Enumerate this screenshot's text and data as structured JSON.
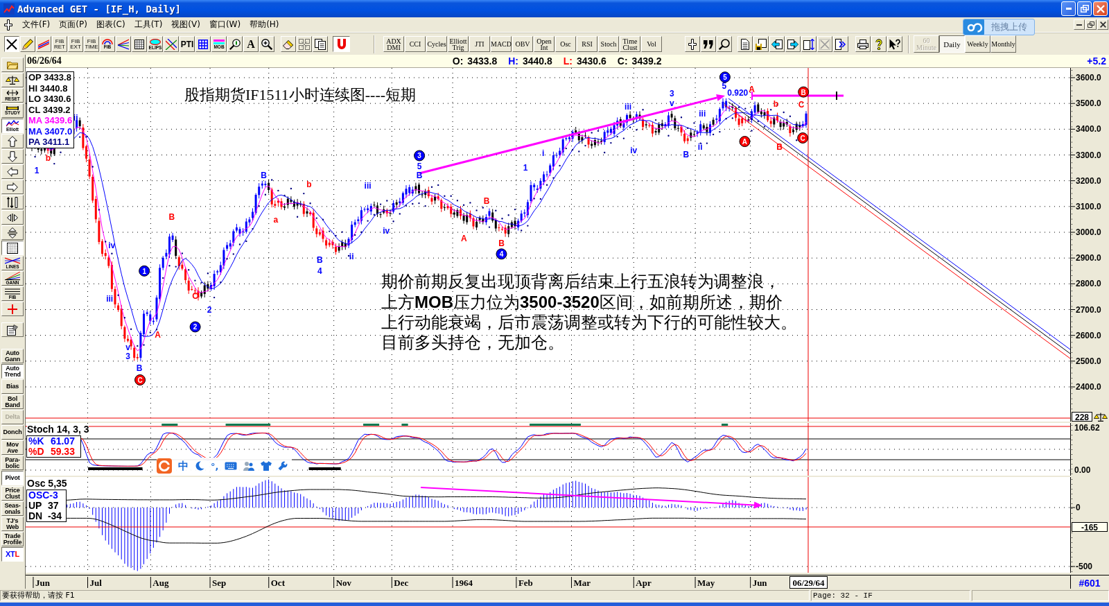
{
  "window": {
    "title": "Advanced GET - [IF_H, Daily]"
  },
  "menu": [
    "文件(F)",
    "页面(P)",
    "图表(C)",
    "工具(T)",
    "视图(V)",
    "窗口(W)",
    "帮助(H)"
  ],
  "toolbar": {
    "drawing_tools": [
      {
        "on": true
      },
      {
        "on": false
      },
      {
        "on": false
      },
      {
        "label": "FIB RET",
        "on": false
      },
      {
        "label": "FIB EXT",
        "on": false
      },
      {
        "label": "FIB TIME",
        "on": false
      },
      {
        "label": "FIB",
        "on": false
      },
      {
        "on": false
      },
      {
        "on": false
      },
      {
        "label": "ELIPS",
        "on": false
      },
      {
        "on": false
      },
      {
        "label": "PTI",
        "on": false
      },
      {
        "on": false
      },
      {
        "label": "MOB",
        "on": false
      },
      {
        "on": false
      },
      {
        "label": "A",
        "on": false
      },
      {
        "on": false
      }
    ],
    "magnet": {
      "on": true
    },
    "studies": [
      "ADX DMI",
      "CCI",
      "Cycles",
      "Elliott Trig",
      "JTI",
      "MACD",
      "OBV",
      "Open Int",
      "Osc",
      "RSI",
      "Stoch",
      "Time Clust",
      "Vol"
    ],
    "timeframes": [
      {
        "label": "60 Minute",
        "selected": false,
        "disabled": true
      },
      {
        "label": "Daily",
        "selected": true,
        "disabled": false
      },
      {
        "label": "Weekly",
        "selected": false,
        "disabled": false
      },
      {
        "label": "Monthly",
        "selected": false,
        "disabled": false
      }
    ]
  },
  "upload_widget": {
    "label": "拖拽上传"
  },
  "info_bar": {
    "date": "06/26/64",
    "quotes": [
      {
        "label": "O:",
        "value": "3433.8",
        "color": "#000000"
      },
      {
        "label": "H:",
        "value": "3440.8",
        "color": "#0000ff"
      },
      {
        "label": "L:",
        "value": "3430.6",
        "color": "#ff0000"
      },
      {
        "label": "C:",
        "value": "3439.2",
        "color": "#000000"
      }
    ],
    "change": "+5.2"
  },
  "sidebar": {
    "tools": [
      {
        "on": false
      },
      {
        "on": false
      },
      {
        "label": "RESET",
        "on": false
      },
      {
        "label": "STUDY",
        "on": false
      },
      {
        "label": "Elliott",
        "on": true
      },
      {
        "on": false
      },
      {
        "on": false
      },
      {
        "on": false
      },
      {
        "on": false
      },
      {
        "on": false
      },
      {
        "on": false
      },
      {
        "on": false
      },
      {
        "on": true
      },
      {
        "label": "LINES",
        "on": false
      },
      {
        "label": "GANN",
        "on": false
      },
      {
        "label": "FIB",
        "on": false
      },
      {
        "on": false
      },
      {
        "on": false
      }
    ],
    "studies": [
      {
        "label": "Auto Gann",
        "on": false,
        "disabled": false
      },
      {
        "label": "Auto Trend",
        "on": true,
        "disabled": false
      },
      {
        "label": "Bias",
        "on": false,
        "disabled": false
      },
      {
        "label": "Bol Band",
        "on": false,
        "disabled": false
      },
      {
        "label": "Delta",
        "on": false,
        "disabled": true
      },
      {
        "label": "Donch",
        "on": false,
        "disabled": false
      },
      {
        "label": "Mov Ave",
        "on": false,
        "disabled": false
      },
      {
        "label": "Para-bolic",
        "on": false,
        "disabled": false
      },
      {
        "label": "Pivot",
        "on": true,
        "disabled": false
      },
      {
        "label": "Price Clust",
        "on": false,
        "disabled": false
      },
      {
        "label": "Seas-onals",
        "on": false,
        "disabled": false
      },
      {
        "label": "TJ's Web",
        "on": false,
        "disabled": false
      },
      {
        "label": "Trade Profile",
        "on": false,
        "disabled": false
      },
      {
        "parts": [
          {
            "text": "XT",
            "color": "#0000ff"
          },
          {
            "text": "L",
            "color": "#ff0000"
          }
        ],
        "on": true,
        "disabled": false
      }
    ]
  },
  "price_chart": {
    "title": "股指期货IF1511小时连续图----短期",
    "legend": [
      {
        "label": "OP",
        "value": "3433.8",
        "color": "#000000"
      },
      {
        "label": "HI",
        "value": "3440.8",
        "color": "#000000"
      },
      {
        "label": "LO",
        "value": "3430.6",
        "color": "#000000"
      },
      {
        "label": "CL",
        "value": "3439.2",
        "color": "#000000"
      },
      {
        "label": "MA",
        "value": "3439.6",
        "color": "#ff00ff"
      },
      {
        "label": "MA",
        "value": "3407.0",
        "color": "#0000ff"
      },
      {
        "label": "PA",
        "value": "3411.1",
        "color": "#000080"
      }
    ],
    "note": [
      "期价前期反复出现顶背离后结束上行五浪转为调整浪，",
      "上方**MOB**压力位为**3500-3520**区间，如前期所述，期价",
      "上行动能衰竭，后市震荡调整或转为下行的可能性较大。",
      "目前多头持仓，无加仓。"
    ],
    "wave_labels": [
      {
        "text": "1",
        "kind": "plain",
        "color": "#0000ff"
      },
      {
        "text": "b",
        "kind": "plain",
        "color": "#ff0000"
      },
      {
        "text": "ii",
        "kind": "plain",
        "color": "#0000ff"
      },
      {
        "text": "iv",
        "kind": "plain",
        "color": "#0000ff"
      },
      {
        "text": "iii",
        "kind": "plain",
        "color": "#0000ff"
      },
      {
        "text": "v",
        "kind": "plain",
        "color": "#0000ff"
      },
      {
        "text": "3",
        "kind": "plain",
        "color": "#0000ff"
      },
      {
        "text": "B",
        "kind": "plain",
        "color": "#0000ff"
      },
      {
        "text": "C",
        "kind": "marker",
        "color": "#ff0000"
      },
      {
        "text": "1",
        "kind": "marker",
        "color": "#0000ff"
      },
      {
        "text": "A",
        "kind": "plain",
        "color": "#ff0000"
      },
      {
        "text": "B",
        "kind": "plain",
        "color": "#ff0000"
      },
      {
        "text": "C",
        "kind": "plain",
        "color": "#ff0000"
      },
      {
        "text": "2",
        "kind": "marker",
        "color": "#0000ff"
      },
      {
        "text": "2",
        "kind": "plain",
        "color": "#0000ff"
      },
      {
        "text": "B",
        "kind": "plain",
        "color": "#0000ff"
      },
      {
        "text": "a",
        "kind": "plain",
        "color": "#ff0000"
      },
      {
        "text": "b",
        "kind": "plain",
        "color": "#ff0000"
      },
      {
        "text": "B",
        "kind": "plain",
        "color": "#0000ff"
      },
      {
        "text": "4",
        "kind": "plain",
        "color": "#0000ff"
      },
      {
        "text": "ii",
        "kind": "plain",
        "color": "#0000ff"
      },
      {
        "text": "iii",
        "kind": "plain",
        "color": "#0000ff"
      },
      {
        "text": "iv",
        "kind": "plain",
        "color": "#0000ff"
      },
      {
        "text": "3",
        "kind": "marker",
        "color": "#0000ff"
      },
      {
        "text": "5",
        "kind": "plain",
        "color": "#0000ff"
      },
      {
        "text": "B",
        "kind": "plain",
        "color": "#0000ff"
      },
      {
        "text": "A",
        "kind": "plain",
        "color": "#ff0000"
      },
      {
        "text": "B",
        "kind": "plain",
        "color": "#ff0000"
      },
      {
        "text": "B",
        "kind": "plain",
        "color": "#ff0000"
      },
      {
        "text": "4",
        "kind": "marker",
        "color": "#0000ff"
      },
      {
        "text": "1",
        "kind": "plain",
        "color": "#0000ff"
      },
      {
        "text": "i",
        "kind": "plain",
        "color": "#0000ff"
      },
      {
        "text": "iii",
        "kind": "plain",
        "color": "#0000ff"
      },
      {
        "text": "3",
        "kind": "plain",
        "color": "#0000ff"
      },
      {
        "text": "v",
        "kind": "plain",
        "color": "#0000ff"
      },
      {
        "text": "iv",
        "kind": "plain",
        "color": "#0000ff"
      },
      {
        "text": "iii",
        "kind": "plain",
        "color": "#0000ff"
      },
      {
        "text": "ii",
        "kind": "plain",
        "color": "#0000ff"
      },
      {
        "text": "B",
        "kind": "plain",
        "color": "#0000ff"
      },
      {
        "text": "5",
        "kind": "marker",
        "color": "#0000ff"
      },
      {
        "text": "5",
        "kind": "plain",
        "color": "#0000ff"
      },
      {
        "text": "0.920",
        "kind": "plain",
        "color": "#0000ff"
      },
      {
        "text": "B",
        "kind": "marker",
        "color": "#ff0000"
      },
      {
        "text": "A",
        "kind": "plain",
        "color": "#ff0000"
      },
      {
        "text": "b",
        "kind": "plain",
        "color": "#ff0000"
      },
      {
        "text": "C",
        "kind": "plain",
        "color": "#ff0000"
      },
      {
        "text": "A",
        "kind": "marker",
        "color": "#ff0000"
      },
      {
        "text": "B",
        "kind": "plain",
        "color": "#ff0000"
      },
      {
        "text": "C",
        "kind": "marker",
        "color": "#ff0000"
      }
    ],
    "y_axis": [
      "3600.0",
      "3500.0",
      "3400.0",
      "3300.0",
      "3200.0",
      "3100.0",
      "3000.0",
      "2900.0",
      "2800.0",
      "2700.0",
      "2600.0",
      "2500.0",
      "2400.0"
    ],
    "last_value": "228"
  },
  "stochastic": {
    "title": "Stoch 14, 3, 3",
    "legend": [
      {
        "label": "%K",
        "value": "61.07",
        "color": "#0000ff"
      },
      {
        "label": "%D",
        "value": "59.33",
        "color": "#ff0000"
      }
    ],
    "y_axis": [
      "106.62",
      "0.00"
    ]
  },
  "oscillator": {
    "title": "Osc 5,35",
    "legend": [
      {
        "label": "OSC-3",
        "color": "#0000ff"
      },
      {
        "label": "UP",
        "value": "37",
        "color": "#000000"
      },
      {
        "label": "DN",
        "value": "-34",
        "color": "#000000"
      }
    ],
    "y_axis": [
      "0",
      "-500"
    ],
    "level": "-165"
  },
  "x_axis": {
    "months": [
      "Jun",
      "Jul",
      "Aug",
      "Sep",
      "Oct",
      "Nov",
      "Dec",
      "1964",
      "Feb",
      "Mar",
      "Apr",
      "May",
      "Jun"
    ],
    "cursor_date": "06/29/64",
    "bar_count": "#601"
  },
  "ime_bar": {
    "mode": "中",
    "punctuation": "°,"
  },
  "status_bar": {
    "help": "要获得帮助，请按 F1",
    "page": "Page: 32 - IF"
  }
}
